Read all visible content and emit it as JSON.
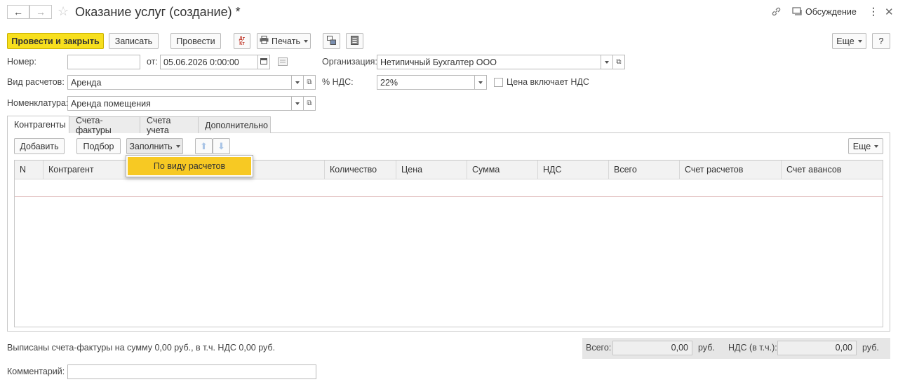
{
  "window": {
    "title": "Оказание услуг (создание) *",
    "discussion_label": "Обсуждение"
  },
  "toolbar": {
    "post_and_close": "Провести и закрыть",
    "save": "Записать",
    "post": "Провести",
    "dt_kt": "Дт Кт",
    "print": "Печать",
    "more": "Еще",
    "help": "?"
  },
  "form": {
    "number_label": "Номер:",
    "number_value": "",
    "date_from_label": "от:",
    "date_value": "05.06.2026  0:00:00",
    "org_label": "Организация:",
    "org_value": "Нетипичный Бухгалтер ООО",
    "calc_type_label": "Вид расчетов:",
    "calc_type_value": "Аренда",
    "vat_label": "% НДС:",
    "vat_value": "22%",
    "price_incl_vat_label": "Цена включает НДС",
    "price_incl_vat_checked": false,
    "nomenclature_label": "Номенклатура:",
    "nomenclature_value": "Аренда помещения"
  },
  "tabs": [
    {
      "label": "Контрагенты",
      "active": true
    },
    {
      "label": "Счета-фактуры",
      "active": false
    },
    {
      "label": "Счета учета",
      "active": false
    },
    {
      "label": "Дополнительно",
      "active": false
    }
  ],
  "table_toolbar": {
    "add": "Добавить",
    "selection": "Подбор",
    "fill": "Заполнить",
    "more": "Еще"
  },
  "fill_menu": {
    "items": [
      "По виду расчетов"
    ]
  },
  "table": {
    "columns": [
      "N",
      "Контрагент",
      "Количество",
      "Цена",
      "Сумма",
      "НДС",
      "Всего",
      "Счет расчетов",
      "Счет авансов"
    ],
    "rows": []
  },
  "footer": {
    "invoices_text": "Выписаны счета-фактуры на сумму 0,00 руб., в т.ч. НДС 0,00 руб.",
    "total_label": "Всего:",
    "total_value": "0,00",
    "total_currency": "руб.",
    "vat_incl_label": "НДС (в т.ч.):",
    "vat_incl_value": "0,00",
    "vat_currency": "руб.",
    "comment_label": "Комментарий:",
    "comment_value": ""
  }
}
